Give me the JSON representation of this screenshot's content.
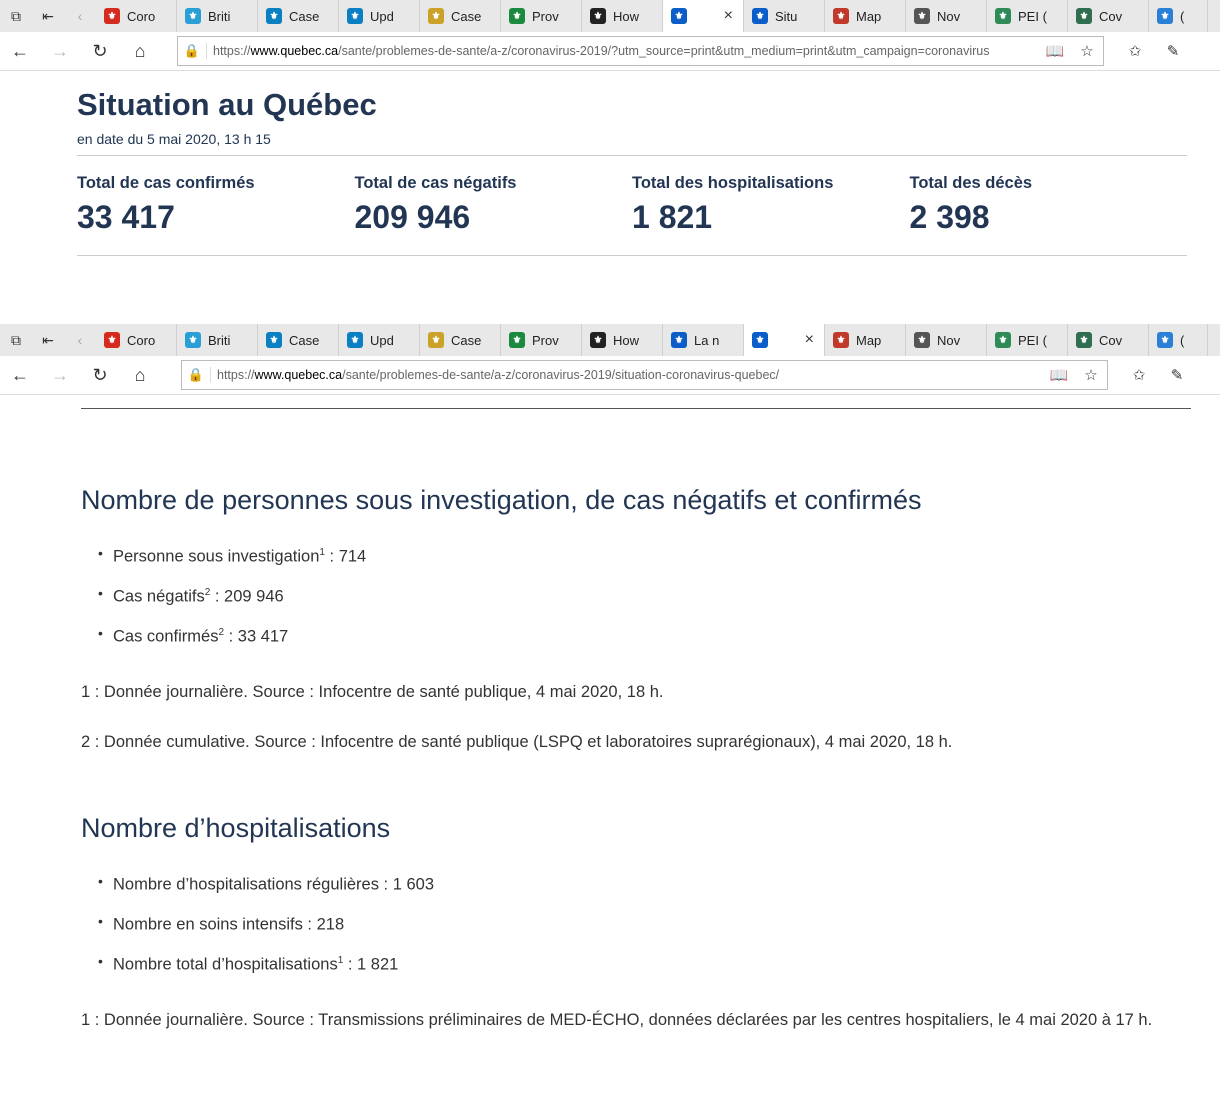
{
  "browser_top": {
    "tabs": [
      {
        "title": "Coro",
        "icon": "maple-leaf-icon",
        "color": "#d52b1e"
      },
      {
        "title": "Briti",
        "icon": "bc-shield-icon",
        "color": "#2a9fd6"
      },
      {
        "title": "Case",
        "icon": "alberta-icon",
        "color": "#0a7fc1"
      },
      {
        "title": "Upd",
        "icon": "alberta-icon",
        "color": "#0a7fc1"
      },
      {
        "title": "Case",
        "icon": "manitoba-icon",
        "color": "#c9a227"
      },
      {
        "title": "Prov",
        "icon": "ontario-icon",
        "color": "#1b8a3e"
      },
      {
        "title": "How",
        "icon": "shield-icon",
        "color": "#222222"
      },
      {
        "title": "",
        "icon": "fleur-de-lis-icon",
        "color": "#0b5ec9",
        "active": true
      },
      {
        "title": "Situ",
        "icon": "fleur-de-lis-icon",
        "color": "#0b5ec9"
      },
      {
        "title": "Map",
        "icon": "new-brunswick-icon",
        "color": "#c0392b"
      },
      {
        "title": "Nov",
        "icon": "nova-scotia-icon",
        "color": "#555555"
      },
      {
        "title": "PEI (",
        "icon": "pei-icon",
        "color": "#2e8b57"
      },
      {
        "title": "Cov",
        "icon": "globe-icon",
        "color": "#2f6f4f"
      },
      {
        "title": "(",
        "icon": "nl-icon",
        "color": "#2a7fd6"
      }
    ],
    "url_prefix": "https://",
    "url_host": "www.quebec.ca",
    "url_path": "/sante/problemes-de-sante/a-z/coronavirus-2019/?utm_source=print&utm_medium=print&utm_campaign=coronavirus"
  },
  "situation": {
    "title": "Situation au Québec",
    "date": "en date du 5 mai 2020, 13 h 15",
    "stats": [
      {
        "label": "Total de cas confirmés",
        "value": "33 417"
      },
      {
        "label": "Total de cas négatifs",
        "value": "209 946"
      },
      {
        "label": "Total des hospitalisations",
        "value": "1 821"
      },
      {
        "label": "Total des décès",
        "value": "2 398"
      }
    ]
  },
  "browser_bottom": {
    "tabs": [
      {
        "title": "Coro",
        "icon": "maple-leaf-icon",
        "color": "#d52b1e"
      },
      {
        "title": "Briti",
        "icon": "bc-shield-icon",
        "color": "#2a9fd6"
      },
      {
        "title": "Case",
        "icon": "alberta-icon",
        "color": "#0a7fc1"
      },
      {
        "title": "Upd",
        "icon": "alberta-icon",
        "color": "#0a7fc1"
      },
      {
        "title": "Case",
        "icon": "manitoba-icon",
        "color": "#c9a227"
      },
      {
        "title": "Prov",
        "icon": "ontario-icon",
        "color": "#1b8a3e"
      },
      {
        "title": "How",
        "icon": "shield-icon",
        "color": "#222222"
      },
      {
        "title": "La n",
        "icon": "fleur-de-lis-icon",
        "color": "#0b5ec9"
      },
      {
        "title": "",
        "icon": "fleur-de-lis-icon",
        "color": "#0b5ec9",
        "active": true
      },
      {
        "title": "Map",
        "icon": "new-brunswick-icon",
        "color": "#c0392b"
      },
      {
        "title": "Nov",
        "icon": "nova-scotia-icon",
        "color": "#555555"
      },
      {
        "title": "PEI (",
        "icon": "pei-icon",
        "color": "#2e8b57"
      },
      {
        "title": "Cov",
        "icon": "globe-icon",
        "color": "#2f6f4f"
      },
      {
        "title": "(",
        "icon": "nl-icon",
        "color": "#2a7fd6"
      }
    ],
    "url_prefix": "https://",
    "url_host": "www.quebec.ca",
    "url_path": "/sante/problemes-de-sante/a-z/coronavirus-2019/situation-coronavirus-quebec/"
  },
  "investigation": {
    "heading": "Nombre de personnes sous investigation, de cas négatifs et confirmés",
    "items": [
      {
        "label": "Personne sous investigation",
        "sup": "1",
        "value": " : 714"
      },
      {
        "label": "Cas négatifs",
        "sup": "2",
        "value": " : 209 946"
      },
      {
        "label": "Cas confirmés",
        "sup": "2",
        "value": " : 33 417"
      }
    ],
    "notes": [
      "1 : Donnée journalière. Source : Infocentre de santé publique, 4 mai 2020, 18 h.",
      "2 : Donnée cumulative. Source : Infocentre de santé publique (LSPQ et laboratoires suprarégionaux), 4 mai 2020, 18 h."
    ]
  },
  "hospitalisations": {
    "heading": "Nombre d’hospitalisations",
    "items": [
      {
        "label": "Nombre d’hospitalisations régulières",
        "sup": "",
        "value": " : 1 603"
      },
      {
        "label": "Nombre en soins intensifs",
        "sup": "",
        "value": " : 218"
      },
      {
        "label": "Nombre total d’hospitalisations",
        "sup": "1",
        "value": " : 1 821"
      }
    ],
    "notes": [
      "1 : Donnée journalière. Source : Transmissions préliminaires de MED-ÉCHO, données déclarées par les centres hospitaliers, le 4 mai 2020 à 17 h."
    ]
  }
}
